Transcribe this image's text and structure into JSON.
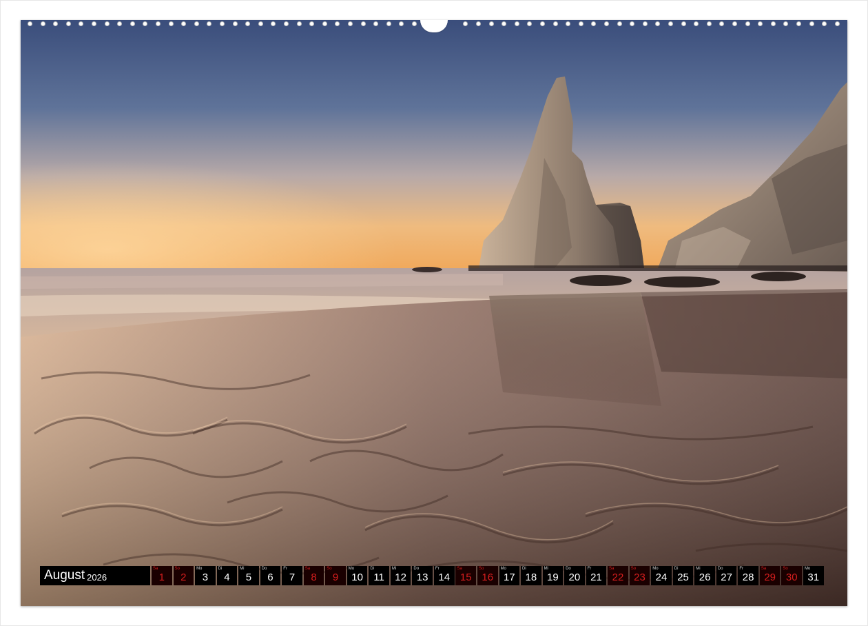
{
  "calendar": {
    "month": "August",
    "year": "2026",
    "days": [
      {
        "num": "1",
        "weekday": "Sa",
        "weekend": true
      },
      {
        "num": "2",
        "weekday": "So",
        "weekend": true
      },
      {
        "num": "3",
        "weekday": "Mo",
        "weekend": false
      },
      {
        "num": "4",
        "weekday": "Di",
        "weekend": false
      },
      {
        "num": "5",
        "weekday": "Mi",
        "weekend": false
      },
      {
        "num": "6",
        "weekday": "Do",
        "weekend": false
      },
      {
        "num": "7",
        "weekday": "Fr",
        "weekend": false
      },
      {
        "num": "8",
        "weekday": "Sa",
        "weekend": true
      },
      {
        "num": "9",
        "weekday": "So",
        "weekend": true
      },
      {
        "num": "10",
        "weekday": "Mo",
        "weekend": false
      },
      {
        "num": "11",
        "weekday": "Di",
        "weekend": false
      },
      {
        "num": "12",
        "weekday": "Mi",
        "weekend": false
      },
      {
        "num": "13",
        "weekday": "Do",
        "weekend": false
      },
      {
        "num": "14",
        "weekday": "Fr",
        "weekend": false
      },
      {
        "num": "15",
        "weekday": "Sa",
        "weekend": true
      },
      {
        "num": "16",
        "weekday": "So",
        "weekend": true
      },
      {
        "num": "17",
        "weekday": "Mo",
        "weekend": false
      },
      {
        "num": "18",
        "weekday": "Di",
        "weekend": false
      },
      {
        "num": "19",
        "weekday": "Mi",
        "weekend": false
      },
      {
        "num": "20",
        "weekday": "Do",
        "weekend": false
      },
      {
        "num": "21",
        "weekday": "Fr",
        "weekend": false
      },
      {
        "num": "22",
        "weekday": "Sa",
        "weekend": true
      },
      {
        "num": "23",
        "weekday": "So",
        "weekend": true
      },
      {
        "num": "24",
        "weekday": "Mo",
        "weekend": false
      },
      {
        "num": "25",
        "weekday": "Di",
        "weekend": false
      },
      {
        "num": "26",
        "weekday": "Mi",
        "weekend": false
      },
      {
        "num": "27",
        "weekday": "Do",
        "weekend": false
      },
      {
        "num": "28",
        "weekday": "Fr",
        "weekend": false
      },
      {
        "num": "29",
        "weekday": "Sa",
        "weekend": true
      },
      {
        "num": "30",
        "weekday": "So",
        "weekend": true
      },
      {
        "num": "31",
        "weekday": "Mo",
        "weekend": false
      }
    ]
  },
  "colors": {
    "sky_top": "#3b4f7a",
    "sky_horizon": "#f2b46a",
    "sand": "#6b4a3e",
    "weekend_red": "#d81e1e",
    "strip_black": "#000000"
  }
}
